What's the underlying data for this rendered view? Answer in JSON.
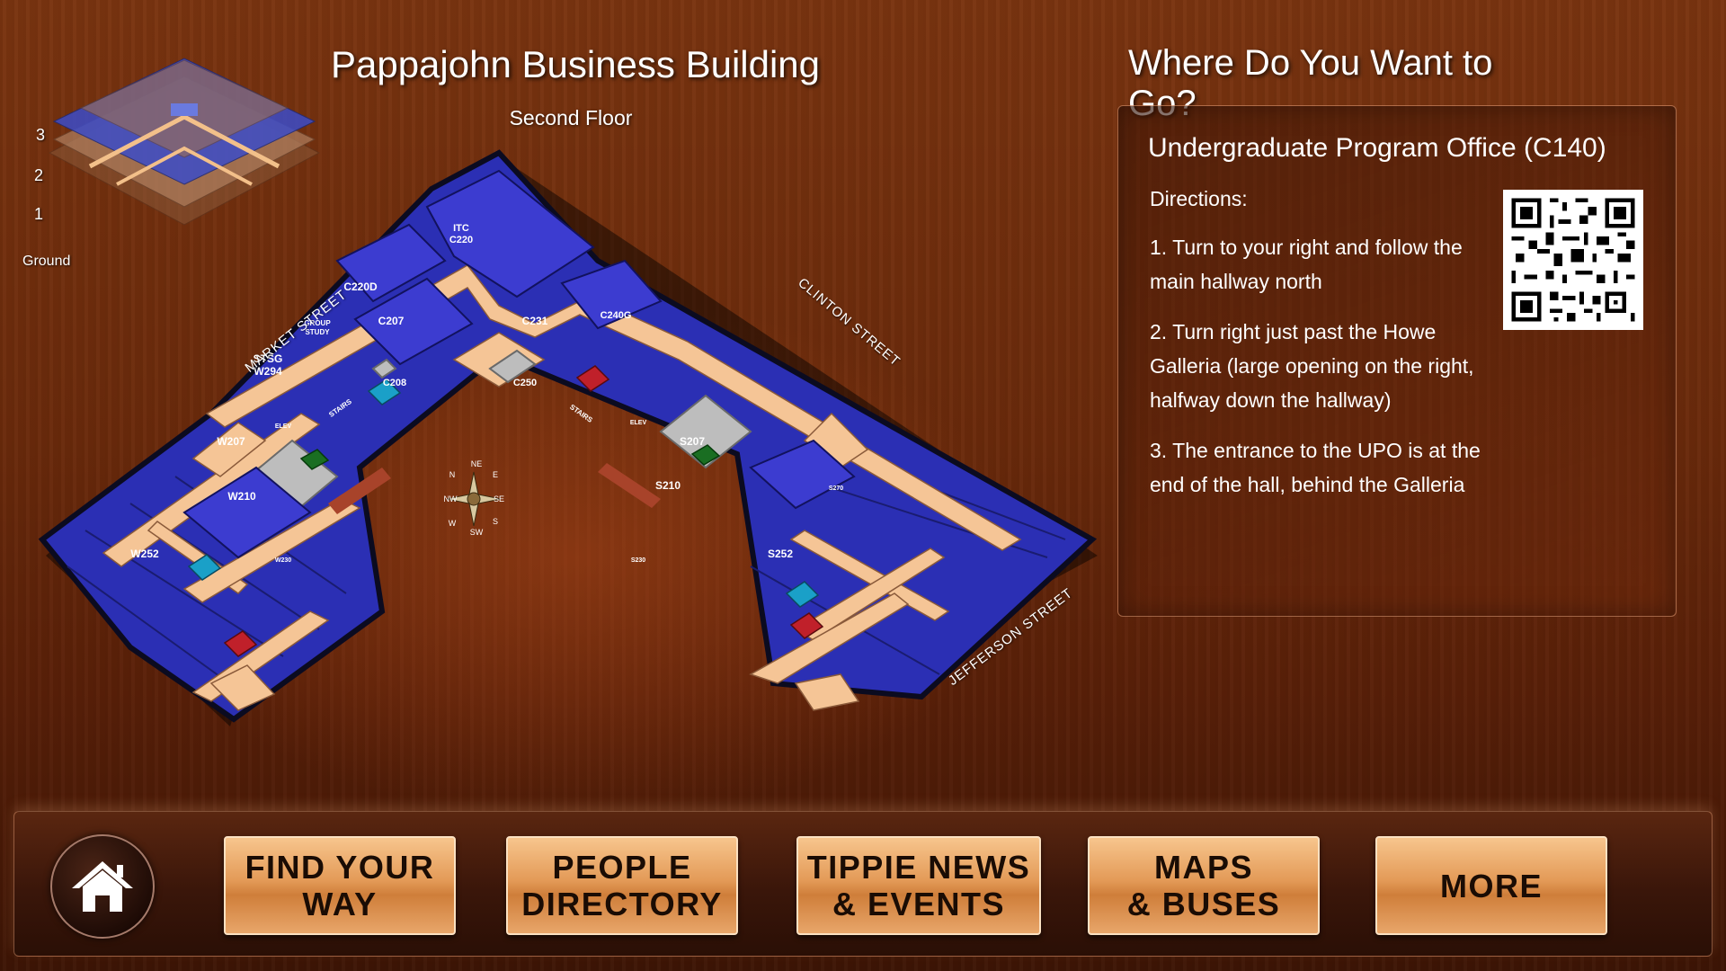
{
  "header": {
    "title": "Pappajohn Business Building",
    "floor": "Second Floor",
    "destination_heading": "Where Do You Want to Go?"
  },
  "mini_map": {
    "floor_labels": [
      "3",
      "2",
      "1",
      "Ground"
    ]
  },
  "map": {
    "streets": [
      "MARKET STREET",
      "CLINTON STREET",
      "JEFFERSON STREET"
    ],
    "rooms": [
      "ITC",
      "C220",
      "C220D",
      "C207",
      "GROUP STUDY",
      "STSG",
      "W294",
      "C231",
      "C240G",
      "C208",
      "C250",
      "W207",
      "W210",
      "W252",
      "W230",
      "S207",
      "S210",
      "S230",
      "S252",
      "S270"
    ],
    "labels": [
      "ELEV",
      "STAIRS"
    ],
    "compass": [
      "NE",
      "E",
      "SE",
      "S",
      "SW",
      "W",
      "NW",
      "N"
    ]
  },
  "directions": {
    "office": "Undergraduate Program Office (C140)",
    "label": "Directions:",
    "steps": [
      "1. Turn to your right and follow the main hallway north",
      "2. Turn right just past the Howe Galleria (large opening on the right, halfway down the hallway)",
      "3. The entrance to the UPO is at the end of the hall, behind the Galleria"
    ]
  },
  "nav": {
    "home_icon": "house-icon",
    "buttons": [
      {
        "line1": "FIND YOUR",
        "line2": "WAY"
      },
      {
        "line1": "PEOPLE",
        "line2": "DIRECTORY"
      },
      {
        "line1": "TIPPIE NEWS",
        "line2": "& EVENTS"
      },
      {
        "line1": "MAPS",
        "line2": "& BUSES"
      },
      {
        "line1": "MORE",
        "line2": ""
      }
    ]
  },
  "colors": {
    "room_blue": "#3b3bc4",
    "hallway": "#f7c598",
    "restroom_red": "#c0202a",
    "elevator_green": "#1a6e22",
    "button_orange": "#e39a57"
  }
}
